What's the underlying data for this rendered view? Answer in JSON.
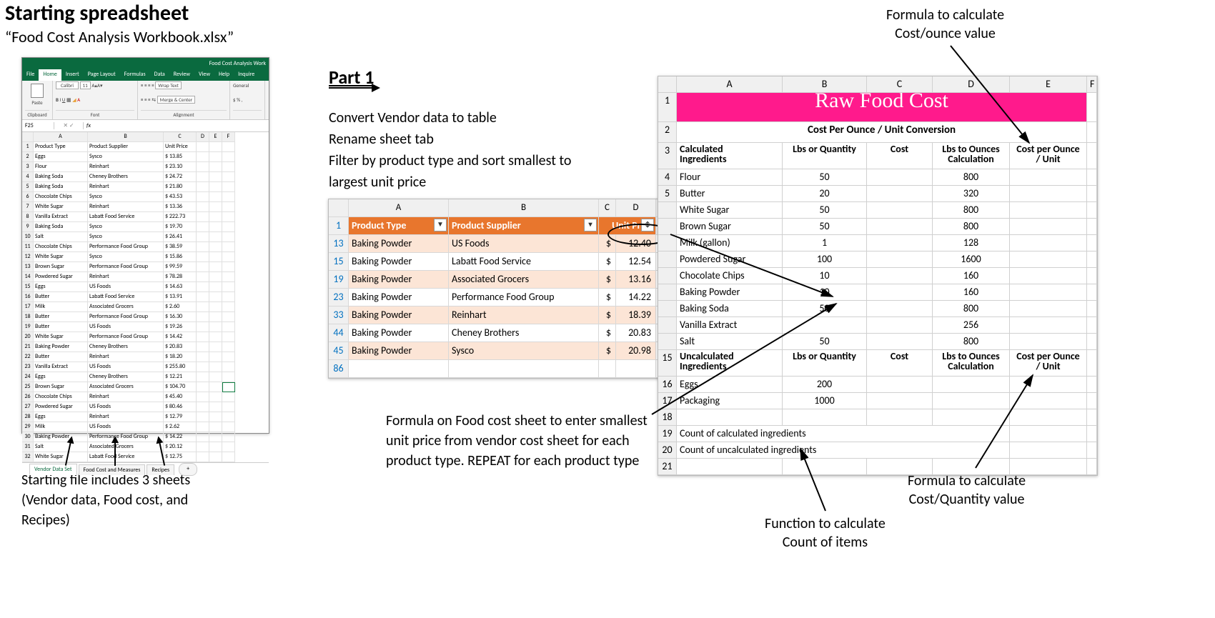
{
  "headings": {
    "title": "Starting spreadsheet",
    "filename": "“Food Cost Analysis Workbook.xlsx”",
    "part1": "Part 1"
  },
  "instructions": "Convert  Vendor data to table\nRename sheet tab\nFilter by product type and sort smallest to largest unit price",
  "captions": {
    "topRight": "Formula to calculate\nCost/ounce value",
    "middle": "Formula on Food cost sheet to enter smallest unit price from vendor cost sheet for each product type.  REPEAT for each product type",
    "leftBottom": "Starting file includes 3 sheets (Vendor data, Food cost, and Recipes)",
    "rightBottom": "Formula to calculate\nCost/Quantity value",
    "countFn": "Function to calculate\nCount of items"
  },
  "excel_thumb": {
    "windowTitle": "Food Cost Analysis Work",
    "ribbonTabs": [
      "File",
      "Home",
      "Insert",
      "Page Layout",
      "Formulas",
      "Data",
      "Review",
      "View",
      "Help",
      "Inquire"
    ],
    "activeRibbonTab": "Home",
    "ribbonGroups": {
      "clipboard": "Clipboard",
      "paste": "Paste",
      "font": "Font",
      "fontFamily": "Calibri",
      "fontSize": "11",
      "alignment": "Alignment",
      "wrap": "Wrap Text",
      "merge": "Merge & Center",
      "general": "General"
    },
    "nameBox": "F25",
    "fxLabel": "fx",
    "colHeaders": [
      "A",
      "B",
      "C",
      "D",
      "E",
      "F"
    ],
    "headerRow": [
      "Product Type",
      "Product Supplier",
      "Unit Price",
      "",
      "",
      ""
    ],
    "rows": [
      [
        "Eggs",
        "Sysco",
        "$",
        "13.85"
      ],
      [
        "Flour",
        "Reinhart",
        "$",
        "23.10"
      ],
      [
        "Baking Soda",
        "Cheney Brothers",
        "$",
        "24.72"
      ],
      [
        "Baking Soda",
        "Reinhart",
        "$",
        "21.80"
      ],
      [
        "Chocolate Chips",
        "Sysco",
        "$",
        "43.53"
      ],
      [
        "White Sugar",
        "Reinhart",
        "$",
        "13.36"
      ],
      [
        "Vanilla Extract",
        "Labatt Food Service",
        "$",
        "222.73"
      ],
      [
        "Baking Soda",
        "Sysco",
        "$",
        "19.70"
      ],
      [
        "Salt",
        "Sysco",
        "$",
        "26.41"
      ],
      [
        "Chocolate Chips",
        "Performance Food Group",
        "$",
        "38.59"
      ],
      [
        "White Sugar",
        "Sysco",
        "$",
        "15.86"
      ],
      [
        "Brown Sugar",
        "Performance Food Group",
        "$",
        "99.59"
      ],
      [
        "Powdered Sugar",
        "Reinhart",
        "$",
        "78.28"
      ],
      [
        "Eggs",
        "US Foods",
        "$",
        "14.63"
      ],
      [
        "Butter",
        "Labatt Food Service",
        "$",
        "13.91"
      ],
      [
        "Milk",
        "Associated Grocers",
        "$",
        "2.60"
      ],
      [
        "Butter",
        "Performance Food Group",
        "$",
        "16.30"
      ],
      [
        "Butter",
        "US Foods",
        "$",
        "19.26"
      ],
      [
        "White Sugar",
        "Performance Food Group",
        "$",
        "14.42"
      ],
      [
        "Baking Powder",
        "Cheney Brothers",
        "$",
        "20.83"
      ],
      [
        "Butter",
        "Reinhart",
        "$",
        "18.20"
      ],
      [
        "Vanilla Extract",
        "US Foods",
        "$",
        "255.80"
      ],
      [
        "Eggs",
        "Cheney Brothers",
        "$",
        "12.21"
      ],
      [
        "Brown Sugar",
        "Associated Grocers",
        "$",
        "104.70"
      ],
      [
        "Chocolate Chips",
        "Reinhart",
        "$",
        "45.40"
      ],
      [
        "Powdered Sugar",
        "US Foods",
        "$",
        "80.46"
      ],
      [
        "Eggs",
        "Reinhart",
        "$",
        "12.79"
      ],
      [
        "Milk",
        "US Foods",
        "$",
        "2.62"
      ],
      [
        "Baking Powder",
        "Performance Food Group",
        "$",
        "14.22"
      ],
      [
        "Salt",
        "Associated Grocers",
        "$",
        "20.12"
      ],
      [
        "White Sugar",
        "Labatt Food Service",
        "$",
        "12.75"
      ]
    ],
    "sheetTabs": [
      "Vendor Data Set",
      "Food Cost and Measures",
      "Recipes"
    ],
    "activeSheetTab": 0
  },
  "filtered_table": {
    "colHeaders": [
      "A",
      "B",
      "C",
      "D"
    ],
    "headers": [
      "Product Type",
      "Product Supplier",
      "Unit Price"
    ],
    "rows": [
      {
        "r": 13,
        "pt": "Baking Powder",
        "ps": "US Foods",
        "up": "12.40"
      },
      {
        "r": 15,
        "pt": "Baking Powder",
        "ps": "Labatt Food Service",
        "up": "12.54"
      },
      {
        "r": 19,
        "pt": "Baking Powder",
        "ps": "Associated Grocers",
        "up": "13.16"
      },
      {
        "r": 23,
        "pt": "Baking Powder",
        "ps": "Performance Food Group",
        "up": "14.22"
      },
      {
        "r": 33,
        "pt": "Baking Powder",
        "ps": "Reinhart",
        "up": "18.39"
      },
      {
        "r": 44,
        "pt": "Baking Powder",
        "ps": "Cheney Brothers",
        "up": "20.83"
      },
      {
        "r": 45,
        "pt": "Baking Powder",
        "ps": "Sysco",
        "up": "20.98"
      }
    ],
    "lastRow": 86
  },
  "raw_food_cost": {
    "title": "Raw Food Cost",
    "subtitle": "Cost Per Ounce / Unit Conversion",
    "colHeaders": [
      "A",
      "B",
      "C",
      "D",
      "E",
      "F"
    ],
    "section1": {
      "h_ing": "Calculated\nIngredients",
      "h_qty": "Lbs or Quantity",
      "h_cost": "Cost",
      "h_calc": "Lbs to Ounces\nCalculation",
      "h_unit": "Cost per Ounce\n/ Unit"
    },
    "calcRows": [
      {
        "r": 4,
        "ing": "Flour",
        "qty": "50",
        "calc": "800"
      },
      {
        "r": 5,
        "ing": "Butter",
        "qty": "20",
        "calc": "320"
      },
      {
        "r": "",
        "ing": "White Sugar",
        "qty": "50",
        "calc": "800"
      },
      {
        "r": "",
        "ing": "Brown Sugar",
        "qty": "50",
        "calc": "800"
      },
      {
        "r": "",
        "ing": "Milk (gallon)",
        "qty": "1",
        "calc": "128"
      },
      {
        "r": "",
        "ing": "Powdered Sugar",
        "qty": "100",
        "calc": "1600"
      },
      {
        "r": "",
        "ing": "Chocolate Chips",
        "qty": "10",
        "calc": "160"
      },
      {
        "r": "",
        "ing": "Baking Powder",
        "qty": "10",
        "calc": "160"
      },
      {
        "r": "",
        "ing": "Baking Soda",
        "qty": "50",
        "calc": "800"
      },
      {
        "r": "",
        "ing": "Vanilla Extract",
        "qty": "",
        "calc": "256"
      },
      {
        "r": "",
        "ing": "Salt",
        "qty": "50",
        "calc": "800"
      }
    ],
    "section2": {
      "r": 15,
      "h_ing": "Uncalculated\nIngredients",
      "h_qty": "Lbs or Quantity",
      "h_cost": "Cost",
      "h_calc": "Lbs to Ounces\nCalculation",
      "h_unit": "Cost per Ounce\n/ Unit"
    },
    "uncalcRows": [
      {
        "r": 16,
        "ing": "Eggs",
        "qty": "200"
      },
      {
        "r": 17,
        "ing": "Packaging",
        "qty": "1000"
      }
    ],
    "blankRow": 18,
    "countRows": [
      {
        "r": 19,
        "label": "Count of calculated ingredients"
      },
      {
        "r": 20,
        "label": "Count of uncalculated ingredients"
      }
    ],
    "tailRow": 21
  }
}
